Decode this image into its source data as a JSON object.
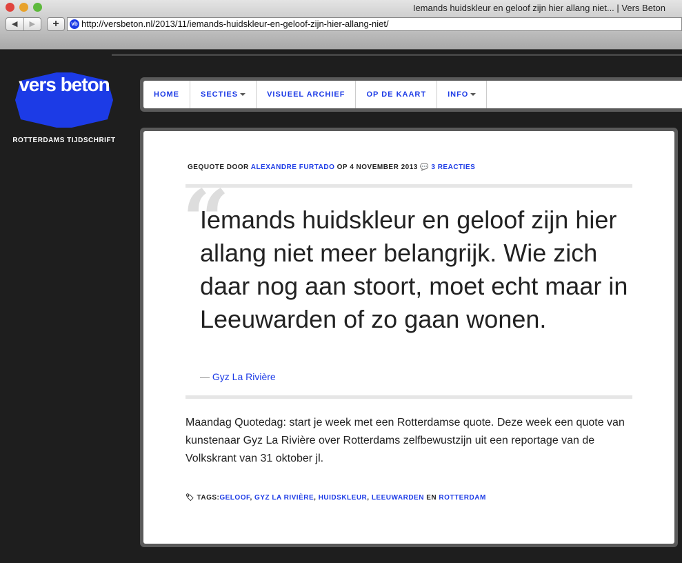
{
  "browser": {
    "title": "Iemands huidskleur en geloof zijn hier allang niet... | Vers Beton",
    "url": "http://versbeton.nl/2013/11/iemands-huidskleur-en-geloof-zijn-hier-allang-niet/",
    "favicon": "vb"
  },
  "site": {
    "logo": "vers beton",
    "tagline": "ROTTERDAMS TIJDSCHRIFT"
  },
  "nav": [
    "HOME",
    "SECTIES",
    "VISUEEL ARCHIEF",
    "OP DE KAART",
    "INFO"
  ],
  "post": {
    "meta_prefix": "GEQUOTE DOOR",
    "author": "ALEXANDRE FURTADO",
    "meta_date": "OP 4 NOVEMBER 2013",
    "comments": "3 REACTIES",
    "quote": "Iemands huidskleur en geloof zijn hier allang niet meer belangrijk. Wie zich daar nog aan stoort, moet echt maar in Leeuwarden of zo gaan wonen.",
    "cite_dash": "—",
    "cite": "Gyz La Rivière",
    "body": "Maandag Quotedag: start je week met een Rotterdamse quote. Deze week een quote van kunstenaar Gyz La Rivière over Rotterdams zelfbewustzijn uit een reportage van de Volkskrant van 31 oktober jl.",
    "tags_label": "TAGS:",
    "tags": [
      "GELOOF",
      "GYZ LA RIVIÈRE",
      "HUIDSKLEUR",
      "LEEUWARDEN",
      "ROTTERDAM"
    ],
    "tags_and": "EN"
  }
}
